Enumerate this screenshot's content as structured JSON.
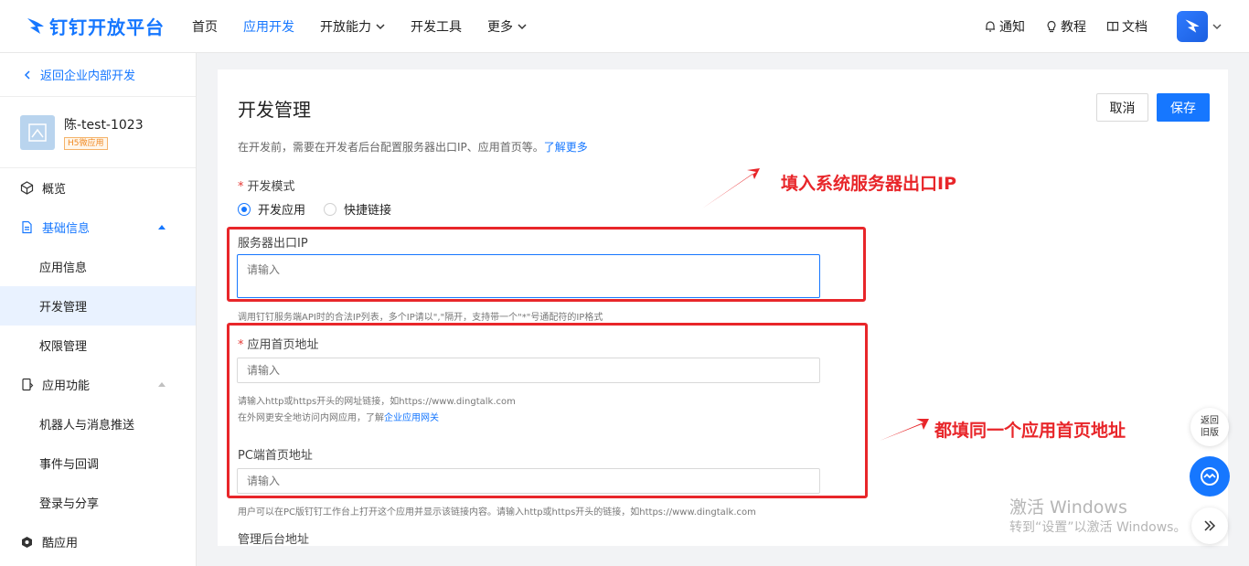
{
  "brand": {
    "name": "钉钉开放平台",
    "color": "#1677ff"
  },
  "nav": {
    "items": [
      {
        "label": "首页",
        "active": false,
        "dropdown": false
      },
      {
        "label": "应用开发",
        "active": true,
        "dropdown": false
      },
      {
        "label": "开放能力",
        "active": false,
        "dropdown": true
      },
      {
        "label": "开发工具",
        "active": false,
        "dropdown": false
      },
      {
        "label": "更多",
        "active": false,
        "dropdown": true
      }
    ],
    "right": {
      "notify": "通知",
      "tutorial": "教程",
      "docs": "文档"
    }
  },
  "sidebar": {
    "back": "返回企业内部开发",
    "app": {
      "name": "陈-test-1023",
      "badge": "H5微应用"
    },
    "items": [
      {
        "label": "概览",
        "icon": "cube-icon"
      },
      {
        "label": "基础信息",
        "icon": "document-icon",
        "expanded": true
      },
      {
        "label": "应用信息"
      },
      {
        "label": "开发管理",
        "active": true
      },
      {
        "label": "权限管理"
      },
      {
        "label": "应用功能",
        "icon": "phone-icon",
        "expanded": true
      },
      {
        "label": "机器人与消息推送"
      },
      {
        "label": "事件与回调"
      },
      {
        "label": "登录与分享"
      },
      {
        "label": "酷应用",
        "icon": "cool-app-icon"
      }
    ]
  },
  "main": {
    "title": "开发管理",
    "cancel": "取消",
    "save": "保存",
    "intro": "在开发前，需要在开发者后台配置服务器出口IP、应用首页等。",
    "learn_more": "了解更多",
    "dev_mode": {
      "label": "开发模式",
      "options": [
        "开发应用",
        "快捷链接"
      ],
      "selected": "开发应用"
    },
    "server_ip": {
      "label": "服务器出口IP",
      "placeholder": "请输入",
      "hint": "调用钉钉服务端API时的合法IP列表，多个IP请以\",\"隔开，支持带一个\"*\"号通配符的IP格式"
    },
    "homepage": {
      "label": "应用首页地址",
      "placeholder": "请输入",
      "hint1": "请输入http或https开头的网址链接，如https://www.dingtalk.com",
      "hint2_prefix": "在外网更安全地访问内网应用，了解",
      "hint2_link": "企业应用网关"
    },
    "pc_homepage": {
      "label": "PC端首页地址",
      "placeholder": "请输入",
      "hint": "用户可以在PC版钉钉工作台上打开这个应用并显示该链接内容。请输入http或https开头的链接，如https://www.dingtalk.com"
    },
    "admin_url": {
      "label": "管理后台地址"
    }
  },
  "annotations": {
    "ip_note": "填入系统服务器出口IP",
    "homepage_note": "都填同一个应用首页地址"
  },
  "floating": {
    "back_line1": "返回",
    "back_line2": "旧版"
  },
  "watermark": {
    "line1": "激活 Windows",
    "line2": "转到“设置”以激活 Windows。"
  }
}
